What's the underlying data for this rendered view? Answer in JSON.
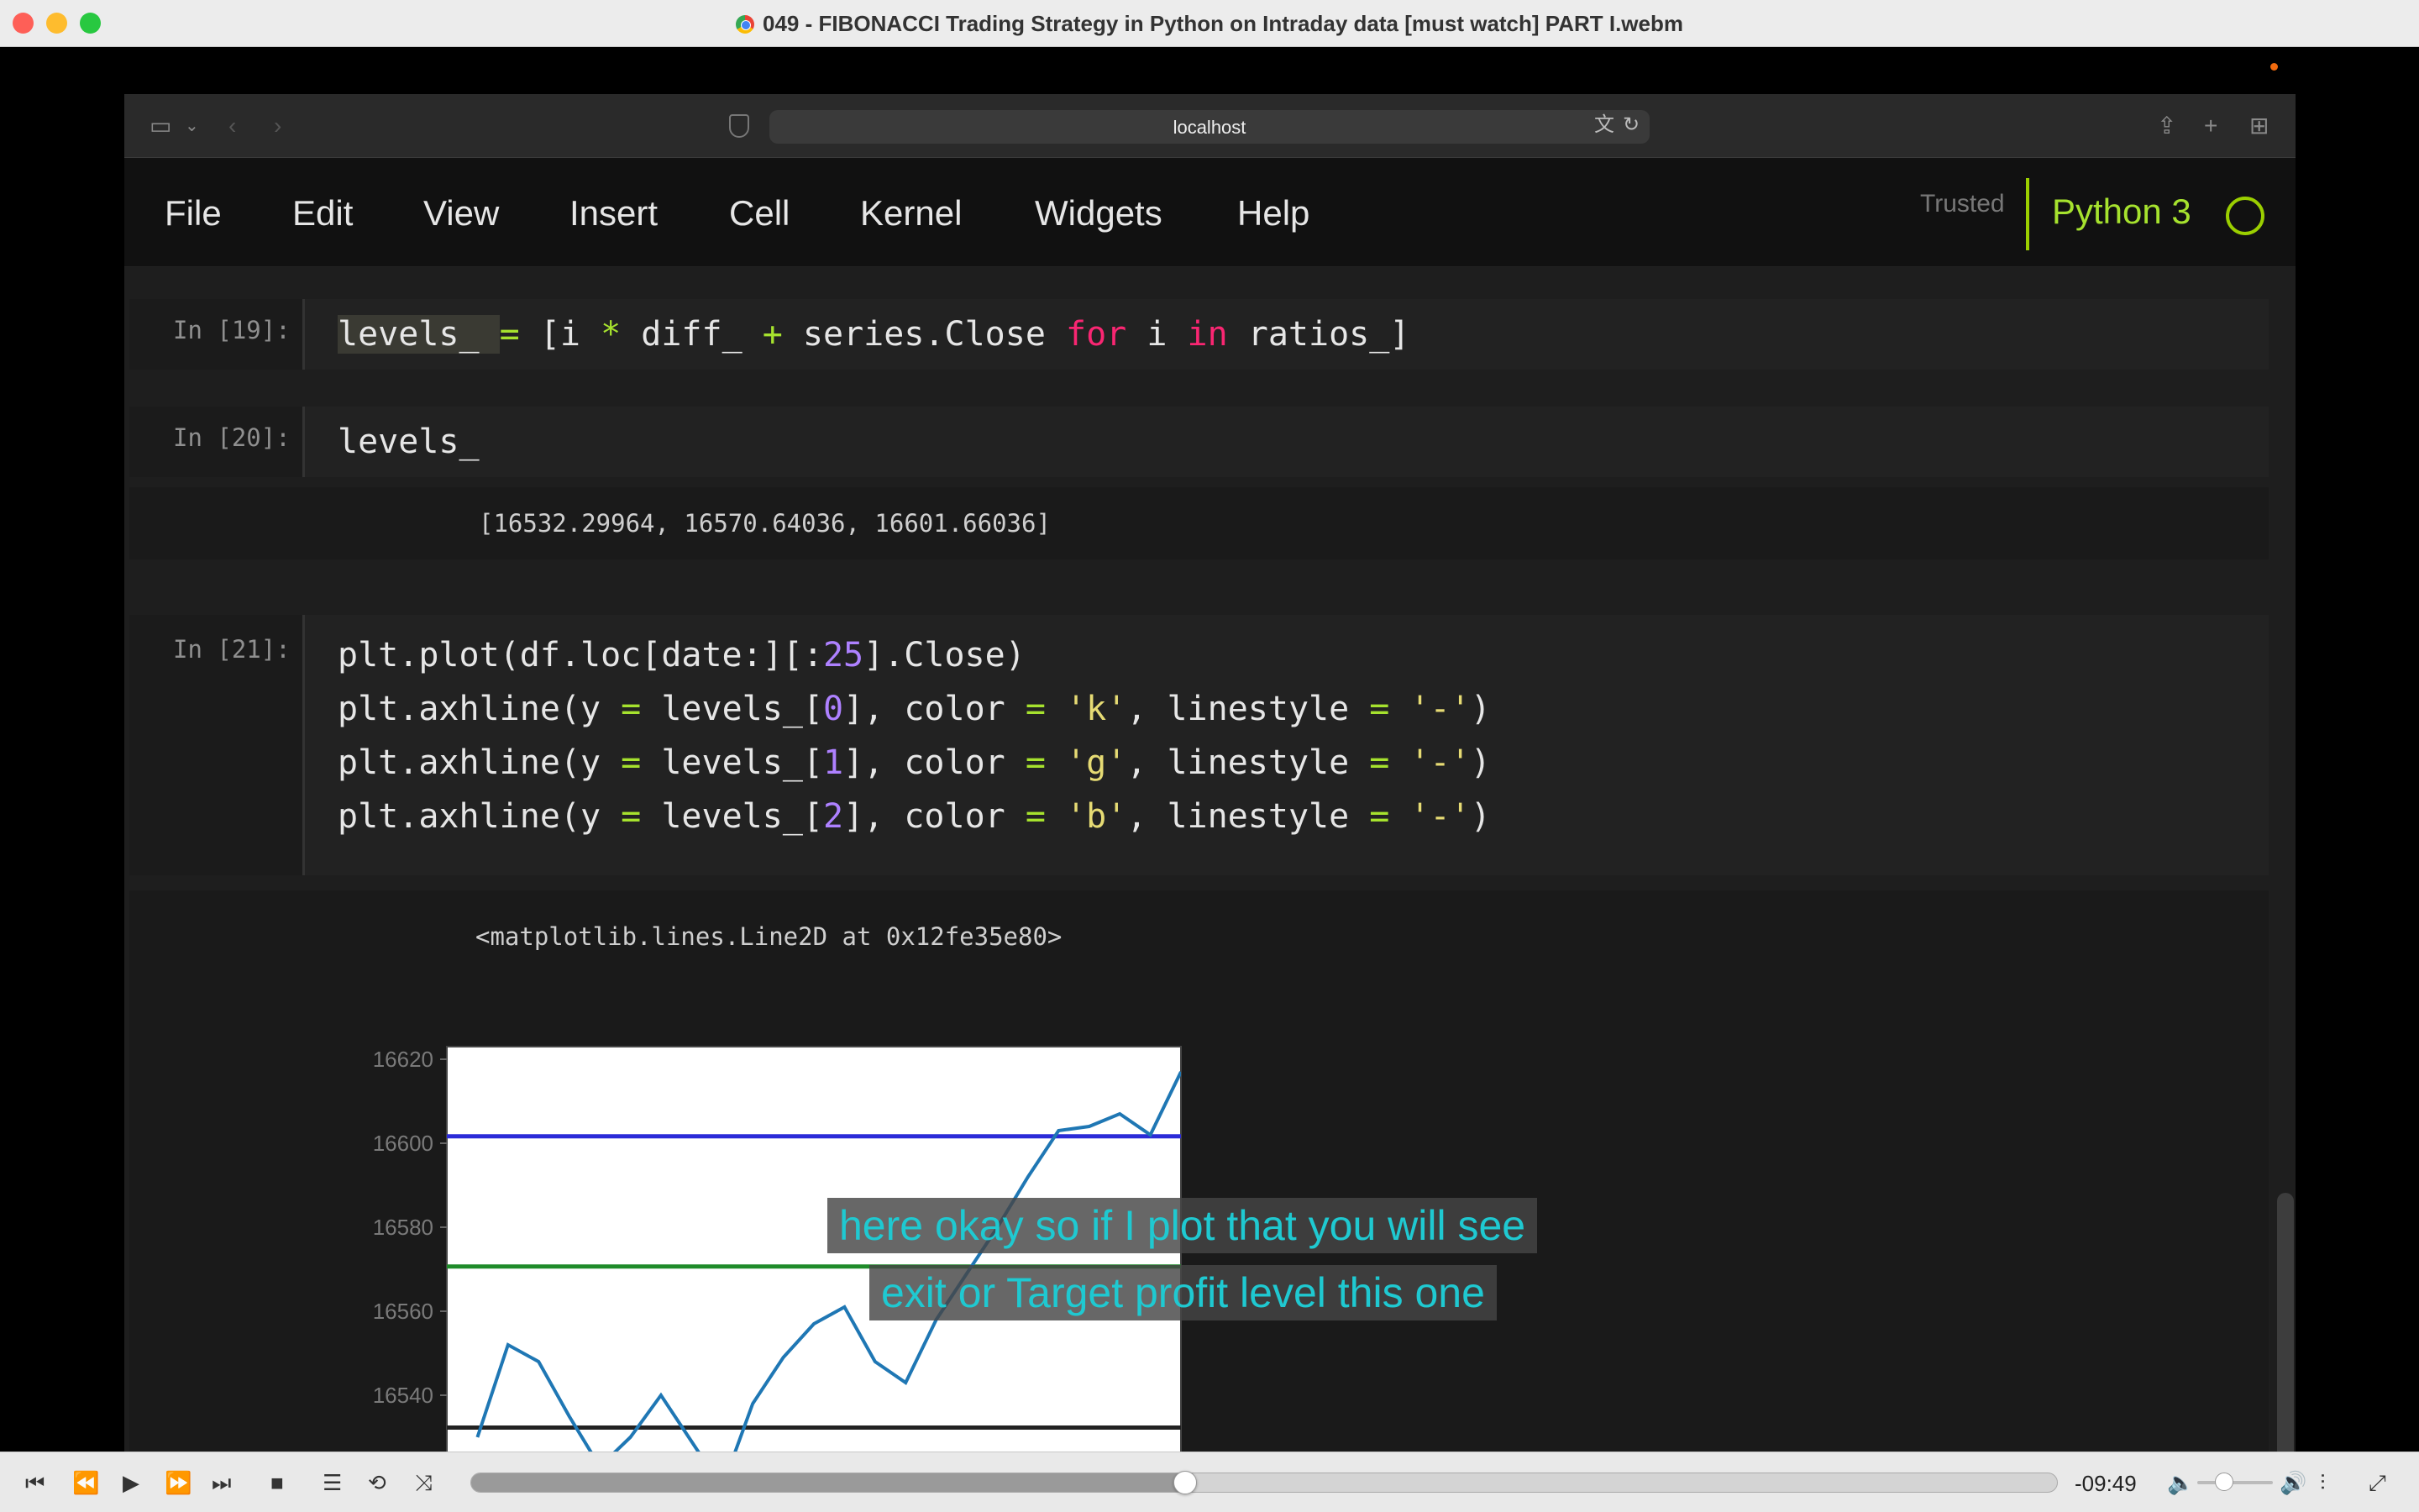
{
  "window": {
    "title": "049 - FIBONACCI Trading Strategy in Python on Intraday data [must watch] PART I.webm"
  },
  "browser": {
    "url": "localhost"
  },
  "jupyter": {
    "menu": [
      "File",
      "Edit",
      "View",
      "Insert",
      "Cell",
      "Kernel",
      "Widgets",
      "Help"
    ],
    "trusted_label": "Trusted",
    "kernel_name": "Python 3"
  },
  "cells": {
    "c19": {
      "prompt": "In [19]:",
      "code": "levels_ = [i * diff_ + series.Close for i in ratios_]"
    },
    "c20": {
      "prompt": "In [20]:",
      "code": "levels_",
      "output": "[16532.29964, 16570.64036, 16601.66036]"
    },
    "c21": {
      "prompt": "In [21]:",
      "code_lines": [
        "plt.plot(df.loc[date:][:25].Close)",
        "plt.axhline(y = levels_[0], color = 'k', linestyle = '-')",
        "plt.axhline(y = levels_[1], color = 'g', linestyle = '-')",
        "plt.axhline(y = levels_[2], color = 'b', linestyle = '-')"
      ],
      "output": "<matplotlib.lines.Line2D at 0x12fe35e80>"
    }
  },
  "chart_data": {
    "type": "line",
    "yticks": [
      16540,
      16560,
      16580,
      16600,
      16620
    ],
    "ylim": [
      16525,
      16623
    ],
    "xlim": [
      0,
      24
    ],
    "grid": false,
    "series": [
      {
        "color": "#1f77b4",
        "x": [
          1,
          2,
          3,
          4,
          5,
          6,
          7,
          8,
          9,
          10,
          11,
          12,
          13,
          14,
          15,
          16,
          17,
          18,
          19,
          20,
          21,
          22,
          23,
          24
        ],
        "y": [
          16530,
          16552,
          16548,
          16535,
          16523,
          16530,
          16540,
          16529,
          16518,
          16538,
          16549,
          16557,
          16561,
          16548,
          16543,
          16558,
          16569,
          16580,
          16592,
          16603,
          16604,
          16607,
          16602,
          16617
        ]
      }
    ],
    "hlines": [
      {
        "y": 16532.29964,
        "color": "#222222"
      },
      {
        "y": 16570.64036,
        "color": "#1f8b2a"
      },
      {
        "y": 16601.66036,
        "color": "#2b2bd8"
      }
    ]
  },
  "subtitles": [
    "here okay so if I plot that you will see",
    "exit or Target profit level this one"
  ],
  "player": {
    "time_remaining": "-09:49",
    "progress": 0.45,
    "volume": 0.36
  }
}
